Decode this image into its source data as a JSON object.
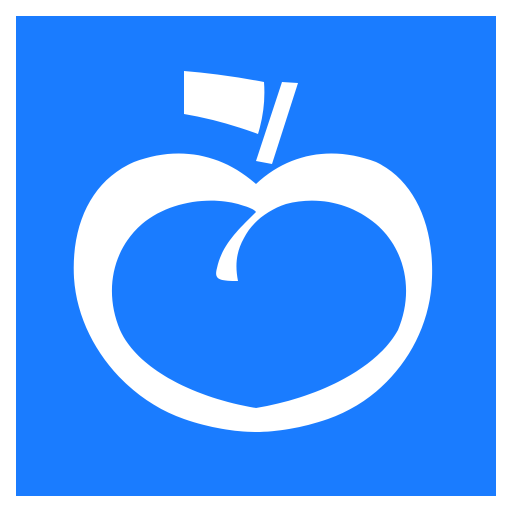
{
  "icon": {
    "name": "peach-icon",
    "background_color": "#1a7cff",
    "foreground_color": "#ffffff"
  }
}
